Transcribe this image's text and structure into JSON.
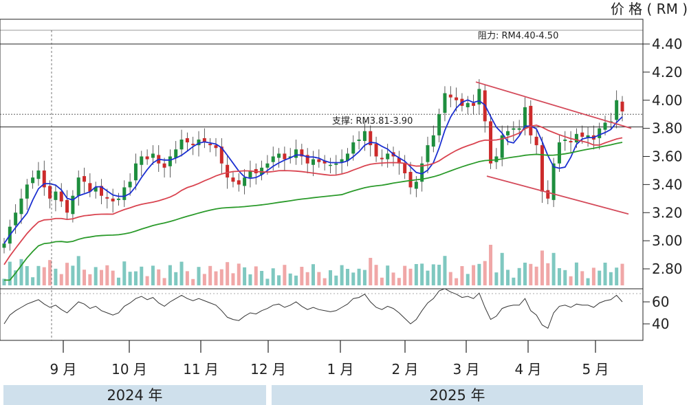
{
  "header": {
    "unit_label": "价 格 ( RM )"
  },
  "colors": {
    "ma_fast": "#1b2fd1",
    "ma_mid": "#d9434f",
    "ma_slow": "#2a9a2a",
    "candle_up": "#1e8e3e",
    "candle_down": "#cc2b2b",
    "vol_up": "#7fc8c0",
    "vol_down": "#f0a7a7",
    "year_band": "#cfe0ec",
    "trendline": "#d44a5a"
  },
  "chart_data": {
    "type": "candlestick",
    "y_axis": {
      "label": "价 格 ( RM )",
      "ticks": [
        "4.40",
        "4.20",
        "4.00",
        "3.80",
        "3.60",
        "3.40",
        "3.20",
        "3.00",
        "2.80"
      ],
      "range": [
        2.7,
        4.52
      ]
    },
    "rsi_axis": {
      "ticks": [
        "60",
        "40"
      ],
      "range": [
        30,
        70
      ]
    },
    "x_axis": {
      "months": [
        "9 月",
        "10 月",
        "11 月",
        "12 月",
        "1 月",
        "2 月",
        "3 月",
        "4 月",
        "5 月"
      ],
      "years": [
        "2024 年",
        "2025 年"
      ]
    },
    "annotations": {
      "resistance": "阻力: RM4.40-4.50",
      "support": "支撑: RM3.81-3.90"
    },
    "levels": {
      "resistance": [
        4.4,
        4.5
      ],
      "support": [
        3.81,
        3.9
      ]
    },
    "ohlc_close": [
      2.98,
      3.1,
      3.2,
      3.3,
      3.4,
      3.45,
      3.5,
      3.38,
      3.3,
      3.35,
      3.28,
      3.2,
      3.32,
      3.45,
      3.42,
      3.35,
      3.38,
      3.32,
      3.3,
      3.28,
      3.3,
      3.38,
      3.42,
      3.55,
      3.6,
      3.58,
      3.62,
      3.55,
      3.52,
      3.6,
      3.65,
      3.72,
      3.7,
      3.68,
      3.72,
      3.7,
      3.68,
      3.66,
      3.55,
      3.45,
      3.42,
      3.4,
      3.45,
      3.5,
      3.48,
      3.52,
      3.55,
      3.6,
      3.62,
      3.58,
      3.6,
      3.65,
      3.6,
      3.55,
      3.58,
      3.56,
      3.55,
      3.54,
      3.55,
      3.58,
      3.62,
      3.7,
      3.72,
      3.78,
      3.68,
      3.6,
      3.58,
      3.62,
      3.6,
      3.55,
      3.48,
      3.38,
      3.42,
      3.55,
      3.68,
      3.75,
      3.9,
      4.05,
      4.02,
      4.0,
      3.96,
      3.98,
      3.96,
      4.08,
      3.85,
      3.55,
      3.6,
      3.75,
      3.78,
      3.8,
      3.8,
      3.95,
      3.75,
      3.68,
      3.35,
      3.3,
      3.55,
      3.7,
      3.72,
      3.7,
      3.76,
      3.74,
      3.75,
      3.72,
      3.8,
      3.84,
      3.85,
      4.0,
      3.92
    ],
    "rsi": [
      40,
      48,
      52,
      55,
      58,
      60,
      62,
      58,
      55,
      57,
      53,
      50,
      55,
      60,
      58,
      54,
      56,
      52,
      50,
      48,
      50,
      56,
      59,
      63,
      65,
      62,
      64,
      59,
      56,
      60,
      63,
      66,
      63,
      61,
      63,
      61,
      59,
      57,
      52,
      46,
      44,
      43,
      47,
      50,
      49,
      52,
      54,
      57,
      58,
      55,
      57,
      60,
      56,
      53,
      55,
      53,
      52,
      51,
      52,
      55,
      58,
      63,
      64,
      67,
      60,
      55,
      53,
      56,
      54,
      50,
      45,
      40,
      44,
      52,
      59,
      63,
      70,
      72,
      69,
      67,
      64,
      65,
      63,
      68,
      55,
      44,
      47,
      54,
      56,
      57,
      57,
      63,
      52,
      48,
      39,
      36,
      50,
      56,
      57,
      55,
      58,
      57,
      57,
      55,
      59,
      61,
      62,
      66,
      60
    ]
  }
}
